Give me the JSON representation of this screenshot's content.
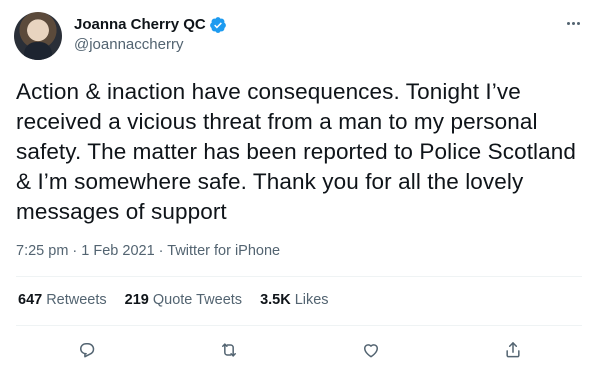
{
  "author": {
    "name": "Joanna Cherry QC",
    "handle": "@joannaccherry",
    "verified": true
  },
  "tweet": {
    "text": "Action & inaction have consequences. Tonight I’ve\nreceived a vicious threat from a man to my personal\nsafety. The matter has been reported to Police Scotland\n& I’m somewhere safe. Thank you for all the lovely\nmessages of support",
    "meta": "7:25 pm · 1 Feb 2021 · Twitter for iPhone"
  },
  "stats": [
    {
      "count": "647",
      "label": "Retweets"
    },
    {
      "count": "219",
      "label": "Quote Tweets"
    },
    {
      "count": "3.5K",
      "label": "Likes"
    }
  ],
  "icons": {
    "more": "more-icon",
    "reply": "reply-icon",
    "retweet": "retweet-icon",
    "like": "like-icon",
    "share": "share-icon",
    "verified": "verified-badge-icon"
  },
  "colors": {
    "text": "#0f1419",
    "secondary": "#536471",
    "verified": "#1d9bf0",
    "divider": "#eff3f4"
  }
}
